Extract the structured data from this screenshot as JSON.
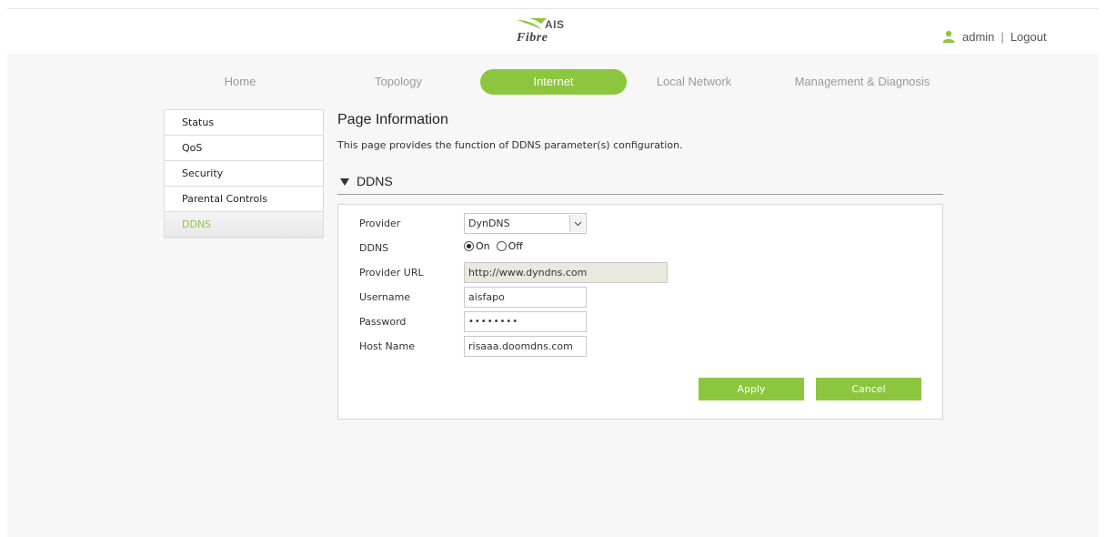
{
  "header": {
    "logo_brand": "AIS",
    "logo_product": "Fibre",
    "user_name": "admin",
    "separator": "|",
    "logout_label": "Logout"
  },
  "nav": {
    "tabs": [
      {
        "label": "Home",
        "active": false
      },
      {
        "label": "Topology",
        "active": false
      },
      {
        "label": "Internet",
        "active": true
      },
      {
        "label": "Local Network",
        "active": false
      },
      {
        "label": "Management & Diagnosis",
        "active": false
      }
    ]
  },
  "sidebar": {
    "items": [
      {
        "label": "Status",
        "active": false
      },
      {
        "label": "QoS",
        "active": false
      },
      {
        "label": "Security",
        "active": false
      },
      {
        "label": "Parental Controls",
        "active": false
      },
      {
        "label": "DDNS",
        "active": true
      }
    ]
  },
  "content": {
    "page_title": "Page Information",
    "page_desc": "This page provides the function of DDNS parameter(s) configuration.",
    "section_title": "DDNS"
  },
  "form": {
    "provider_label": "Provider",
    "provider_value": "DynDNS",
    "ddns_label": "DDNS",
    "ddns_on_label": "On",
    "ddns_off_label": "Off",
    "ddns_selected": "On",
    "provider_url_label": "Provider URL",
    "provider_url_value": "http://www.dyndns.com",
    "username_label": "Username",
    "username_value": "aisfapo",
    "password_label": "Password",
    "password_value": "••••••••",
    "hostname_label": "Host Name",
    "hostname_value": "risaaa.doomdns.com",
    "apply_label": "Apply",
    "cancel_label": "Cancel"
  },
  "colors": {
    "accent": "#8cc63f",
    "panel_bg": "#f7f7f7",
    "readonly_bg": "#ebe9df"
  }
}
